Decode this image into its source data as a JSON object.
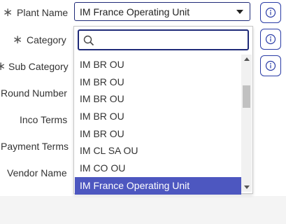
{
  "form": {
    "fields": [
      {
        "label": "Plant Name",
        "required": true
      },
      {
        "label": "Category",
        "required": true
      },
      {
        "label": "Sub Category",
        "required": true
      },
      {
        "label": "Round Number",
        "required": false
      },
      {
        "label": "Inco Terms",
        "required": false
      },
      {
        "label": "Payment Terms",
        "required": false
      },
      {
        "label": "Vendor Name",
        "required": false
      }
    ],
    "required_marker": "∗"
  },
  "plant_select": {
    "value": "IM France Operating Unit",
    "search": {
      "value": "",
      "placeholder": ""
    },
    "options": [
      "IM BR OU",
      "IM BR OU",
      "IM BR OU",
      "IM BR OU",
      "IM BR OU",
      "IM CL SA OU",
      "IM CO OU",
      "IM France Operating Unit"
    ],
    "selected_index": 7
  },
  "info_icon_name": "info-circle-icon",
  "colors": {
    "accent": "#1f2a78",
    "selected_bg": "#4d57c0",
    "footer": "#f4f4f4"
  }
}
